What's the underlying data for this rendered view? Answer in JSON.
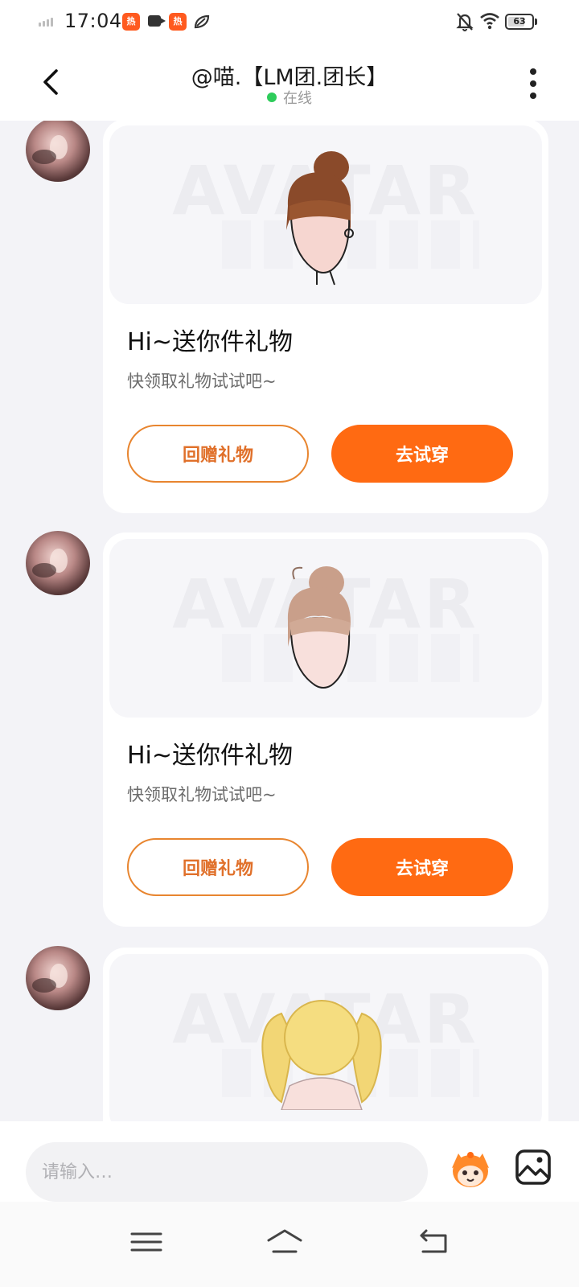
{
  "status_bar": {
    "time": "17:04",
    "battery": "63",
    "app_badge": "热"
  },
  "header": {
    "title": "@喵.【LM团.团长】",
    "status": "在线"
  },
  "messages": [
    {
      "title": "Hi~送你件礼物",
      "subtitle": "快领取礼物试试吧~",
      "watermark": "AVATAR",
      "return_label": "回赠礼物",
      "try_label": "去试穿"
    },
    {
      "title": "Hi~送你件礼物",
      "subtitle": "快领取礼物试试吧~",
      "watermark": "AVATAR",
      "return_label": "回赠礼物",
      "try_label": "去试穿"
    },
    {
      "watermark": "AVATAR"
    }
  ],
  "input": {
    "placeholder": "请输入…"
  },
  "icons": {
    "back": "back-arrow-icon",
    "more": "more-vertical-icon",
    "emoji": "mascot-emoji-icon",
    "image": "image-icon",
    "nav_menu": "menu-icon",
    "nav_home": "home-icon",
    "nav_back": "back-icon"
  },
  "colors": {
    "accent": "#ff6a12",
    "accent_border": "#e8852f",
    "online": "#2ecc5b",
    "background": "#f3f3f7"
  }
}
